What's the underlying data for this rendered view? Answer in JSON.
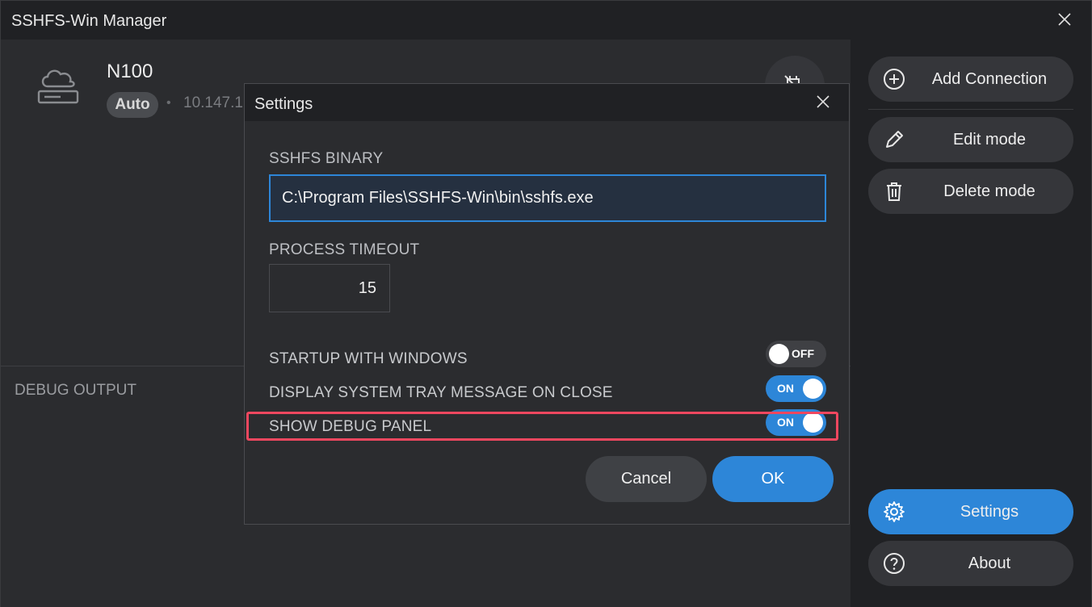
{
  "window": {
    "title": "SSHFS-Win Manager"
  },
  "connection": {
    "name": "N100",
    "mode": "Auto",
    "separator": "•",
    "ip": "10.147.1"
  },
  "debug": {
    "label": "DEBUG OUTPUT"
  },
  "sidebar": {
    "add_connection": "Add Connection",
    "edit_mode": "Edit mode",
    "delete_mode": "Delete mode",
    "settings": "Settings",
    "about": "About"
  },
  "settings_dialog": {
    "title": "Settings",
    "binary_label": "SSHFS BINARY",
    "binary_value": "C:\\Program Files\\SSHFS-Win\\bin\\sshfs.exe",
    "timeout_label": "PROCESS TIMEOUT",
    "timeout_value": "15",
    "toggles": [
      {
        "label": "STARTUP WITH WINDOWS",
        "state": "OFF"
      },
      {
        "label": "DISPLAY SYSTEM TRAY MESSAGE ON CLOSE",
        "state": "ON"
      },
      {
        "label": "SHOW DEBUG PANEL",
        "state": "ON"
      }
    ],
    "cancel_label": "Cancel",
    "ok_label": "OK"
  },
  "colors": {
    "accent": "#2d86d8",
    "highlight": "#f0475f",
    "background": "#2b2c2f",
    "sidebar": "#202124"
  }
}
